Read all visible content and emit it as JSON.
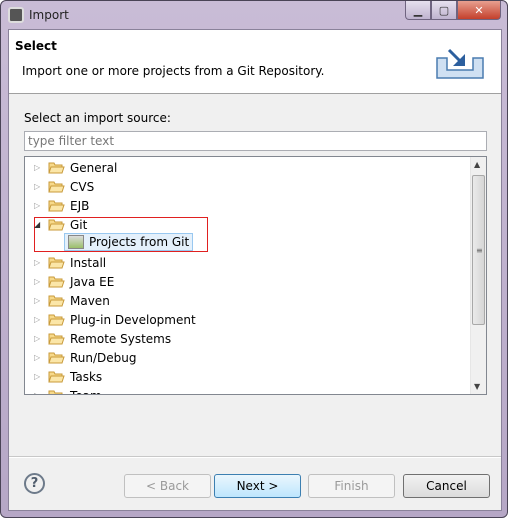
{
  "window": {
    "title": "Import",
    "controls": [
      "minimize",
      "maximize",
      "close"
    ]
  },
  "header": {
    "title": "Select",
    "description": "Import one or more projects from a Git Repository.",
    "icon": "import-icon"
  },
  "source_label": "Select an import source:",
  "filter": {
    "value": "",
    "placeholder": "type filter text"
  },
  "tree": {
    "items": [
      {
        "label": "General",
        "expanded": false
      },
      {
        "label": "CVS",
        "expanded": false
      },
      {
        "label": "EJB",
        "expanded": false
      },
      {
        "label": "Git",
        "expanded": true,
        "children": [
          {
            "label": "Projects from Git",
            "selected": true
          }
        ]
      },
      {
        "label": "Install",
        "expanded": false
      },
      {
        "label": "Java EE",
        "expanded": false
      },
      {
        "label": "Maven",
        "expanded": false
      },
      {
        "label": "Plug-in Development",
        "expanded": false
      },
      {
        "label": "Remote Systems",
        "expanded": false
      },
      {
        "label": "Run/Debug",
        "expanded": false
      },
      {
        "label": "Tasks",
        "expanded": false
      },
      {
        "label": "Team",
        "expanded": false
      }
    ],
    "highlight_color": "#e02020"
  },
  "buttons": {
    "back": "< Back",
    "next": "Next >",
    "finish": "Finish",
    "cancel": "Cancel",
    "help": "?"
  }
}
